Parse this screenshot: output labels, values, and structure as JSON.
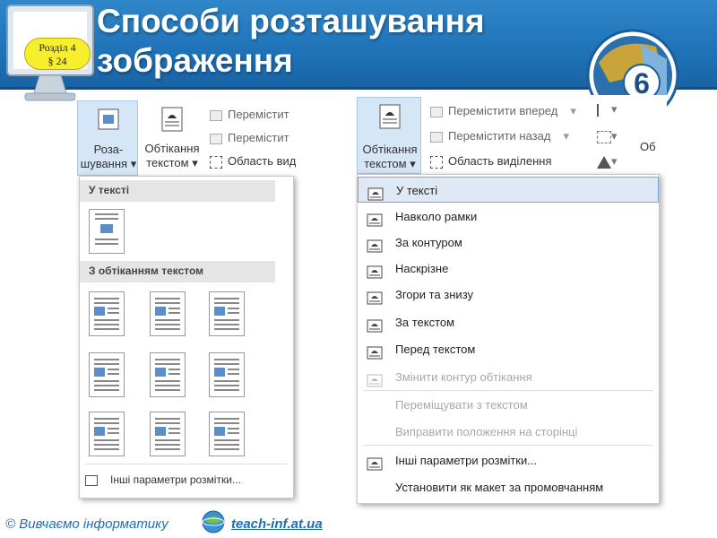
{
  "header": {
    "title_line1": "Способи розташування",
    "title_line2": "зображення",
    "badge_line1": "Розділ 4",
    "badge_line2": "§ 24",
    "logo_number": "6"
  },
  "left_ribbon": {
    "position_button_line1": "Роза-",
    "position_button_line2": "шування",
    "wrap_button_line1": "Обтікання",
    "wrap_button_line2": "текстом",
    "bring_forward": "Перемістит",
    "send_backward": "Перемістит",
    "selection_pane": "Область вид"
  },
  "left_menu": {
    "section_inline": "У тексті",
    "section_wrap": "З обтіканням текстом",
    "more_options": "Інші параметри розмітки..."
  },
  "right_ribbon": {
    "wrap_button_line1": "Обтікання",
    "wrap_button_line2": "текстом",
    "bring_forward": "Перемістити вперед",
    "send_backward": "Перемістити назад",
    "selection_pane": "Область виділення",
    "cut_label": "Об"
  },
  "right_menu": {
    "items": [
      {
        "label": "У тексті"
      },
      {
        "label": "Навколо рамки"
      },
      {
        "label": "За контуром"
      },
      {
        "label": "Наскрізне"
      },
      {
        "label": "Згори та знизу"
      },
      {
        "label": "За текстом"
      },
      {
        "label": "Перед текстом"
      },
      {
        "label": "Змінити контур обтікання"
      },
      {
        "label": "Переміщувати з текстом"
      },
      {
        "label": "Виправити положення на сторінці"
      },
      {
        "label": "Інші параметри розмітки..."
      },
      {
        "label": "Установити як макет за промовчанням"
      }
    ]
  },
  "footer": {
    "copyright": "© Вивчаємо інформатику",
    "site": "teach-inf.at.ua"
  },
  "colors": {
    "header_blue": "#1d6fb4",
    "badge_yellow": "#f7ee2c",
    "link_blue": "#1e6fb5",
    "selected_item": "#dfe9f6"
  }
}
